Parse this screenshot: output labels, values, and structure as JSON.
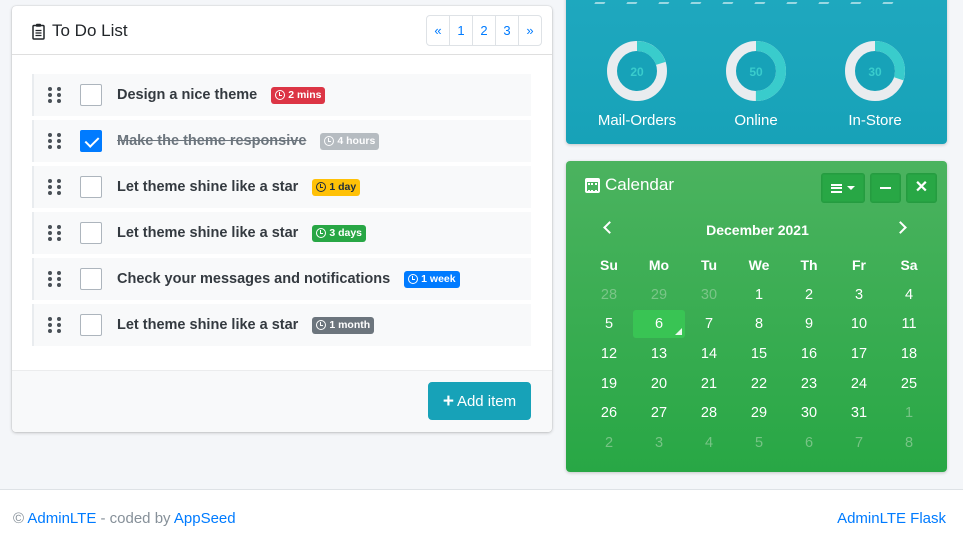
{
  "todo": {
    "title": "To Do List",
    "pagination": [
      "«",
      "1",
      "2",
      "3",
      "»"
    ],
    "items": [
      {
        "text": "Design a nice theme",
        "badge": "2 mins",
        "checked": false
      },
      {
        "text": "Make the theme responsive",
        "badge": "4 hours",
        "checked": true
      },
      {
        "text": "Let theme shine like a star",
        "badge": "1 day",
        "checked": false
      },
      {
        "text": "Let theme shine like a star",
        "badge": "3 days",
        "checked": false
      },
      {
        "text": "Check your messages and notifications",
        "badge": "1 week",
        "checked": false
      },
      {
        "text": "Let theme shine like a star",
        "badge": "1 month",
        "checked": false
      }
    ],
    "add_label": "Add item"
  },
  "stats": {
    "knobs": [
      {
        "value": "20",
        "fraction": 0.2,
        "label": "Mail-Orders"
      },
      {
        "value": "50",
        "fraction": 0.5,
        "label": "Online"
      },
      {
        "value": "30",
        "fraction": 0.3,
        "label": "In-Store"
      }
    ],
    "colors": {
      "track": "#e9ecef",
      "fill": "#39cccc",
      "card": "#17a2b8"
    }
  },
  "calendar": {
    "title": "Calendar",
    "month": "December 2021",
    "weekdays": [
      "Su",
      "Mo",
      "Tu",
      "We",
      "Th",
      "Fr",
      "Sa"
    ],
    "weeks": [
      [
        "28",
        "29",
        "30",
        "1",
        "2",
        "3",
        "4"
      ],
      [
        "5",
        "6",
        "7",
        "8",
        "9",
        "10",
        "11"
      ],
      [
        "12",
        "13",
        "14",
        "15",
        "16",
        "17",
        "18"
      ],
      [
        "19",
        "20",
        "21",
        "22",
        "23",
        "24",
        "25"
      ],
      [
        "26",
        "27",
        "28",
        "29",
        "30",
        "31",
        "1"
      ],
      [
        "2",
        "3",
        "4",
        "5",
        "6",
        "7",
        "8"
      ]
    ],
    "today": "6",
    "colors": {
      "card": "#28a745"
    }
  },
  "footer": {
    "copyright": "©",
    "brand_link": "AdminLTE",
    "coded_by": " - coded by ",
    "author_link": "AppSeed",
    "right_link": "AdminLTE Flask"
  }
}
